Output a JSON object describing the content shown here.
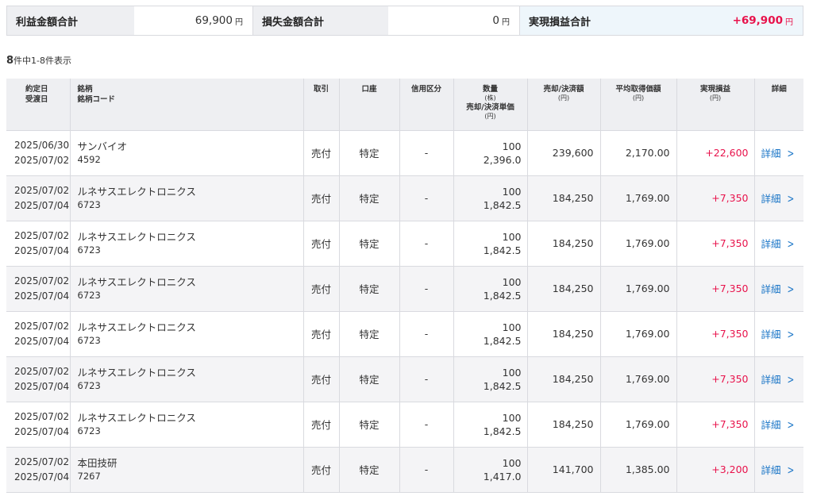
{
  "summary": {
    "profit_label": "利益金額合計",
    "profit_value": "69,900",
    "loss_label": "損失金額合計",
    "loss_value": "0",
    "realized_label": "実現損益合計",
    "realized_value": "+69,900",
    "yen": "円"
  },
  "count": {
    "total": "8",
    "text": "件中1-8件表示"
  },
  "table": {
    "headers": {
      "date1": "約定日",
      "date2": "受渡日",
      "name1": "銘柄",
      "name2": "銘柄コード",
      "trade": "取引",
      "account": "口座",
      "credit": "信用区分",
      "qty1": "数量",
      "qty_unit": "(株)",
      "qty2": "売却/決済単価",
      "qty2_unit": "(円)",
      "amount": "売却/決済額",
      "amount_unit": "(円)",
      "avg": "平均取得価額",
      "avg_unit": "(円)",
      "pl": "実現損益",
      "pl_unit": "(円)",
      "detail": "詳細"
    },
    "rows": [
      {
        "trade_date": "2025/06/30",
        "settle_date": "2025/07/02",
        "name": "サンバイオ",
        "code": "4592",
        "trade": "売付",
        "account": "特定",
        "credit": "-",
        "qty": "100",
        "price": "2,396.0",
        "amount": "239,600",
        "avg": "2,170.00",
        "pl": "+22,600",
        "detail": "詳細"
      },
      {
        "trade_date": "2025/07/02",
        "settle_date": "2025/07/04",
        "name": "ルネサスエレクトロニクス",
        "code": "6723",
        "trade": "売付",
        "account": "特定",
        "credit": "-",
        "qty": "100",
        "price": "1,842.5",
        "amount": "184,250",
        "avg": "1,769.00",
        "pl": "+7,350",
        "detail": "詳細"
      },
      {
        "trade_date": "2025/07/02",
        "settle_date": "2025/07/04",
        "name": "ルネサスエレクトロニクス",
        "code": "6723",
        "trade": "売付",
        "account": "特定",
        "credit": "-",
        "qty": "100",
        "price": "1,842.5",
        "amount": "184,250",
        "avg": "1,769.00",
        "pl": "+7,350",
        "detail": "詳細"
      },
      {
        "trade_date": "2025/07/02",
        "settle_date": "2025/07/04",
        "name": "ルネサスエレクトロニクス",
        "code": "6723",
        "trade": "売付",
        "account": "特定",
        "credit": "-",
        "qty": "100",
        "price": "1,842.5",
        "amount": "184,250",
        "avg": "1,769.00",
        "pl": "+7,350",
        "detail": "詳細"
      },
      {
        "trade_date": "2025/07/02",
        "settle_date": "2025/07/04",
        "name": "ルネサスエレクトロニクス",
        "code": "6723",
        "trade": "売付",
        "account": "特定",
        "credit": "-",
        "qty": "100",
        "price": "1,842.5",
        "amount": "184,250",
        "avg": "1,769.00",
        "pl": "+7,350",
        "detail": "詳細"
      },
      {
        "trade_date": "2025/07/02",
        "settle_date": "2025/07/04",
        "name": "ルネサスエレクトロニクス",
        "code": "6723",
        "trade": "売付",
        "account": "特定",
        "credit": "-",
        "qty": "100",
        "price": "1,842.5",
        "amount": "184,250",
        "avg": "1,769.00",
        "pl": "+7,350",
        "detail": "詳細"
      },
      {
        "trade_date": "2025/07/02",
        "settle_date": "2025/07/04",
        "name": "ルネサスエレクトロニクス",
        "code": "6723",
        "trade": "売付",
        "account": "特定",
        "credit": "-",
        "qty": "100",
        "price": "1,842.5",
        "amount": "184,250",
        "avg": "1,769.00",
        "pl": "+7,350",
        "detail": "詳細"
      },
      {
        "trade_date": "2025/07/02",
        "settle_date": "2025/07/04",
        "name": "本田技研",
        "code": "7267",
        "trade": "売付",
        "account": "特定",
        "credit": "-",
        "qty": "100",
        "price": "1,417.0",
        "amount": "141,700",
        "avg": "1,385.00",
        "pl": "+3,200",
        "detail": "詳細"
      }
    ]
  },
  "colors": {
    "profit": "#e8124b",
    "link": "#1a75c7",
    "header_bg": "#eeeff2",
    "highlight_bg": "#eef6fb"
  },
  "icons": {
    "detail_chevron": "chevron-right-icon"
  }
}
